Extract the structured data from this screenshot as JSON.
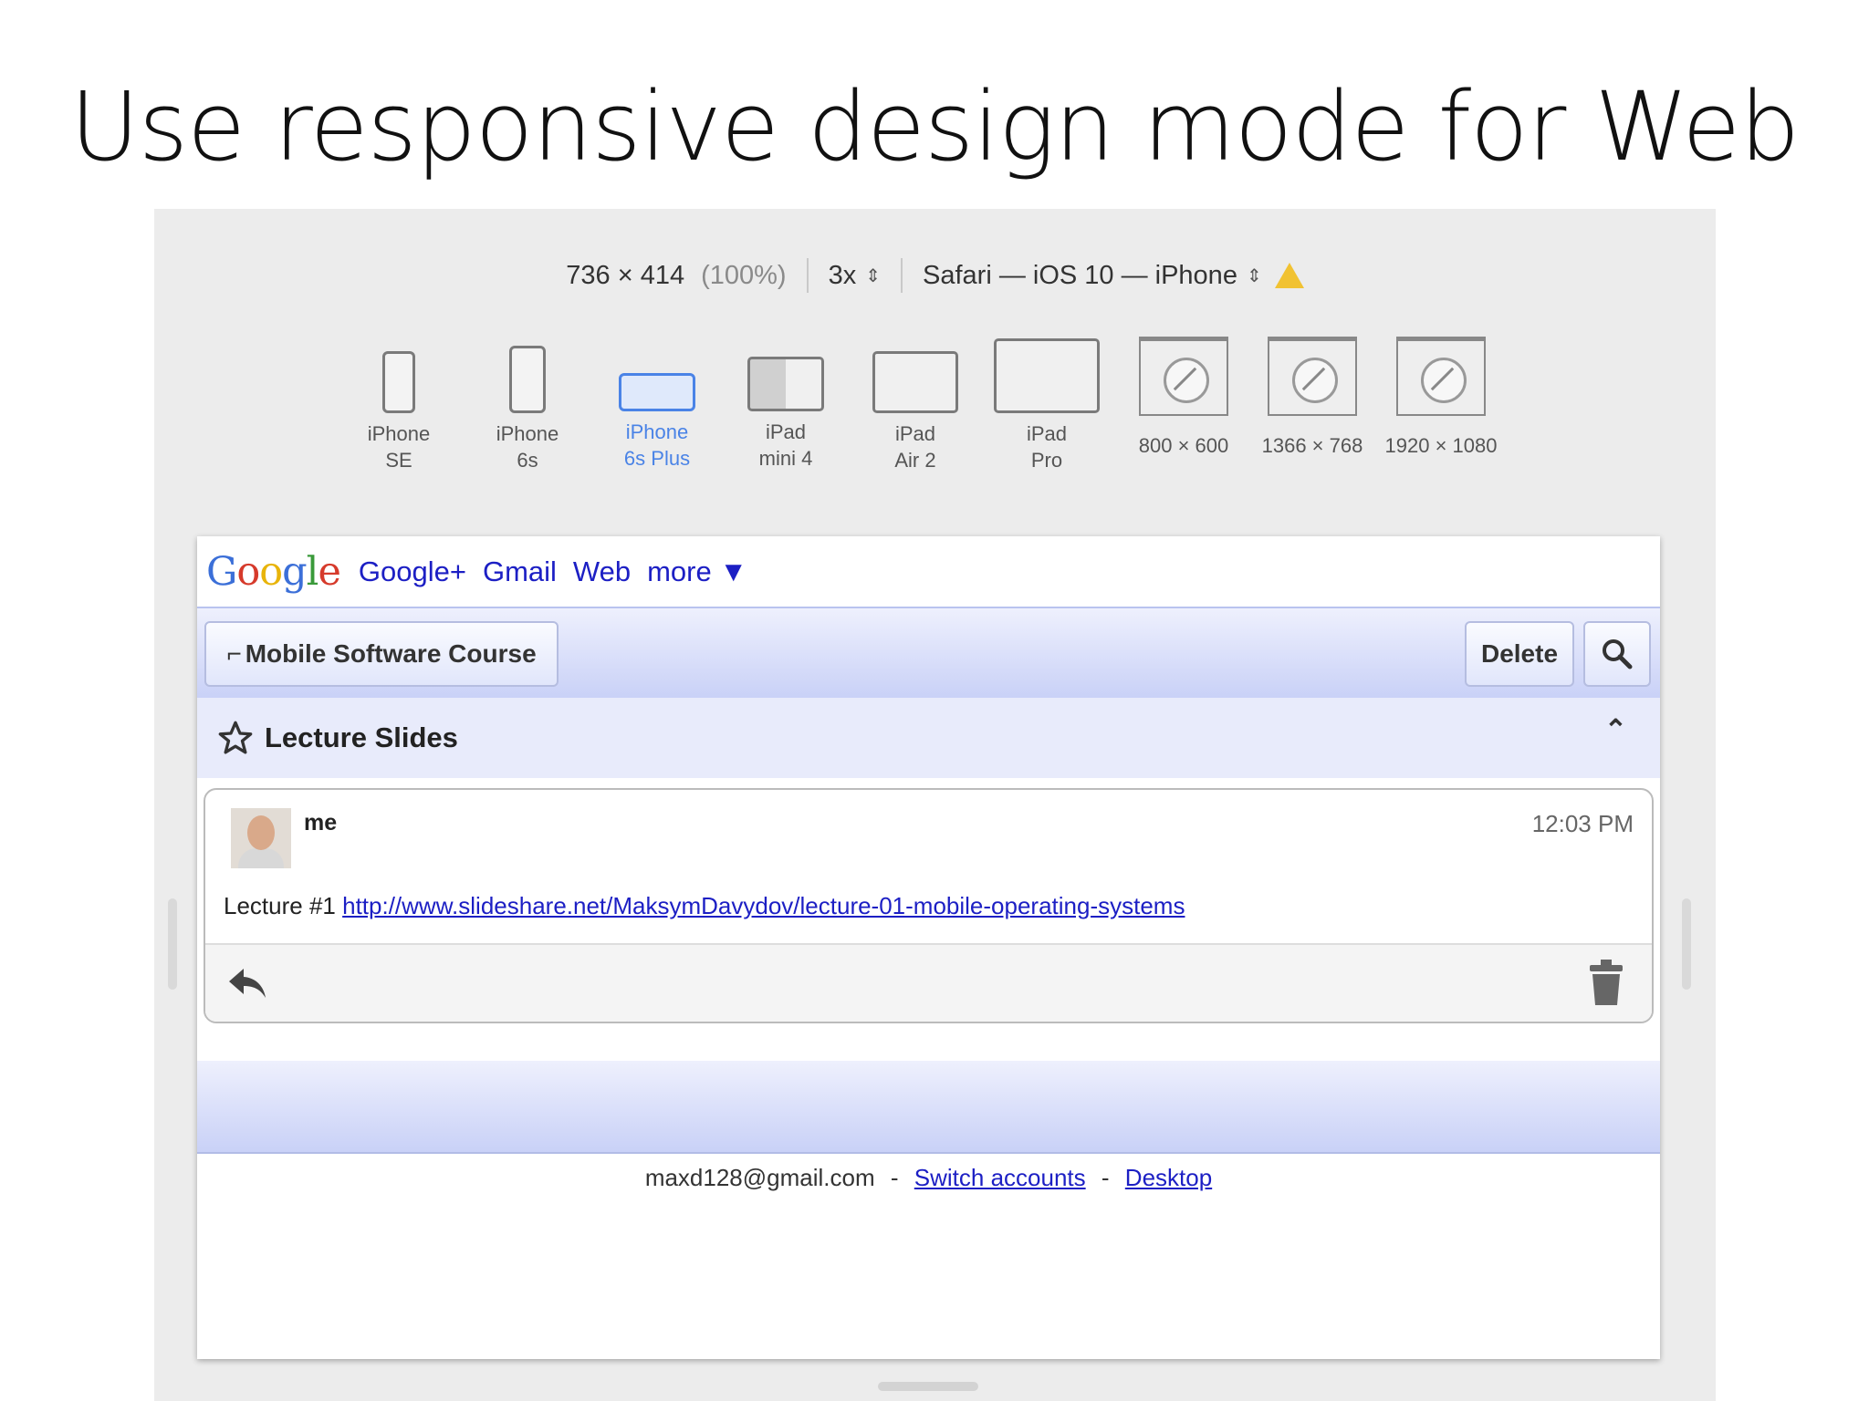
{
  "slide": {
    "title": "Use responsive design mode for Web"
  },
  "rdm": {
    "resolution": "736 × 414",
    "zoom": "(100%)",
    "pixel_ratio": "3x",
    "user_agent": "Safari — iOS 10 — iPhone",
    "devices": [
      {
        "line1": "iPhone",
        "line2": "SE"
      },
      {
        "line1": "iPhone",
        "line2": "6s"
      },
      {
        "line1": "iPhone",
        "line2": "6s Plus"
      },
      {
        "line1": "iPad",
        "line2": "mini 4"
      },
      {
        "line1": "iPad",
        "line2": "Air 2"
      },
      {
        "line1": "iPad",
        "line2": "Pro"
      },
      {
        "line1": "800 × 600"
      },
      {
        "line1": "1366 × 768"
      },
      {
        "line1": "1920 × 1080"
      }
    ],
    "selected_device": "iPhone 6s Plus"
  },
  "gmail": {
    "links": [
      "Google+",
      "Gmail",
      "Web",
      "more ▼"
    ],
    "back_button": "Mobile Software Course",
    "delete_button": "Delete",
    "subject": "Lecture Slides",
    "message": {
      "sender": "me",
      "time": "12:03 PM",
      "body_prefix": "Lecture #1",
      "link": "http://www.slideshare.net/MaksymDavydov/lecture-01-mobile-operating-systems"
    },
    "footer": {
      "email": "maxd128@gmail.com",
      "switch_accounts": "Switch accounts",
      "desktop": "Desktop",
      "separator": "-"
    }
  },
  "colors": {
    "accent_selected": "#4a83e6",
    "link": "#1c1fc4",
    "toolbar_gradient_end": "#c9d1f7"
  }
}
